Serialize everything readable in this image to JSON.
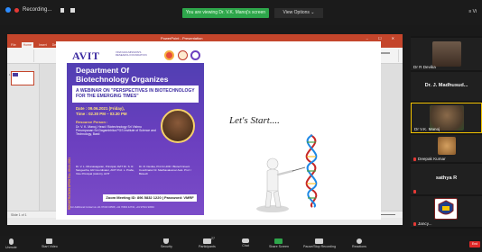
{
  "zoom_top": {
    "recording_label": "Recording...",
    "viewing_banner": "You are viewing Dr. V.K. Manoj's screen",
    "view_options": "View Options ⌄",
    "view_right": "≡ Vi"
  },
  "ppt": {
    "title_file": "PowerPoint - Presentation",
    "window_controls": "– ☐ ✕",
    "tabs": [
      "File",
      "Home",
      "Insert",
      "Design",
      "Transitions",
      "Animations",
      "Slide Show",
      "Review",
      "View",
      "Help"
    ],
    "status_left": "Slide 1 of 1",
    "slide_number": "1"
  },
  "slide": {
    "avit": "AVIT",
    "avit_sub": "VINAYAKA MISSION'S RESEARCH FOUNDATION",
    "department": "Department Of Biotechnology Organizes",
    "webinar": "A WEBINAR ON \"PERSPECTIVES IN BIOTECHNOLOGY FOR THE EMERGING TIMES\"",
    "date": "Date : 09.06.2021 (Friday),",
    "time": "Time : 02.30 PM – 03.30 PM",
    "resource_label": "Resource Person :",
    "resource_name": "Dr. V. K. Manoj, Head / Biotechnology Sri Vishnu Perumpanan Sri Dagambhika PGS Institute of Science and Technology, Basti",
    "vertical": "REGISTRATION OPEN TILL 06.01.2021",
    "conveners_left": "Dr. V. L. Dhanasagaran, Principal, AVIT  Dr. S. R. Sangeetha, HR Coordinator, AVIT  Prof. L. Prabu, Vice Principal (Admin), AVIT",
    "conveners_right": "Dr. R. Devika, Prof & HOD / Biotech  Event Coordinator  Dr. Madhavakumar  Asst. Prof. / Biotech",
    "meeting": "Zoom Meeting ID: 896 5832 1220 | Password: VMRF",
    "footer": "For Additional Contact at +91 97343 34568, +91 70964 42732, +91 97941 93694",
    "lets_start": "Let's Start...."
  },
  "participants": [
    {
      "name": "Dr R Devika"
    },
    {
      "name": "Dr. J. Madhusud..."
    },
    {
      "name": "Dr V.K. Manoj"
    },
    {
      "name": "Deepak Kumar"
    },
    {
      "name": "sathya R"
    },
    {
      "name": "Jancy..."
    }
  ],
  "toolbar": {
    "unmute": "Unmute",
    "start_video": "Start Video",
    "security": "Security",
    "participants": "Participants",
    "participants_count": "27",
    "chat": "Chat",
    "share_screen": "Share Screen",
    "record": "Pause/Stop Recording",
    "reactions": "Reactions",
    "end": "End"
  },
  "colors": {
    "ppt_accent": "#c4452b",
    "zoom_green": "#2ea64b",
    "poster_purple": "#4c3fb0",
    "active_speaker": "#f3c300"
  }
}
